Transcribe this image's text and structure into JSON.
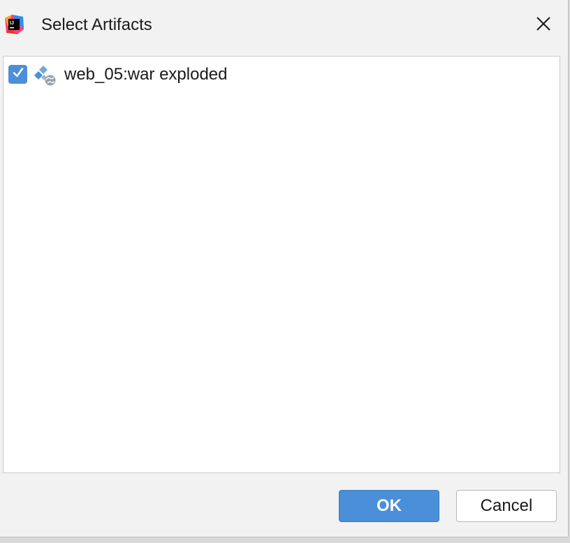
{
  "window": {
    "title": "Select Artifacts",
    "app_icon": "intellij-idea-icon",
    "close_icon": "close-icon"
  },
  "artifacts": {
    "items": [
      {
        "label": "web_05:war exploded",
        "checked": true,
        "icon": "web-artifact-icon"
      }
    ]
  },
  "buttons": {
    "ok_label": "OK",
    "cancel_label": "Cancel"
  },
  "colors": {
    "accent": "#4a8fd8",
    "dialog_background": "#f2f2f2",
    "list_background": "#ffffff"
  }
}
